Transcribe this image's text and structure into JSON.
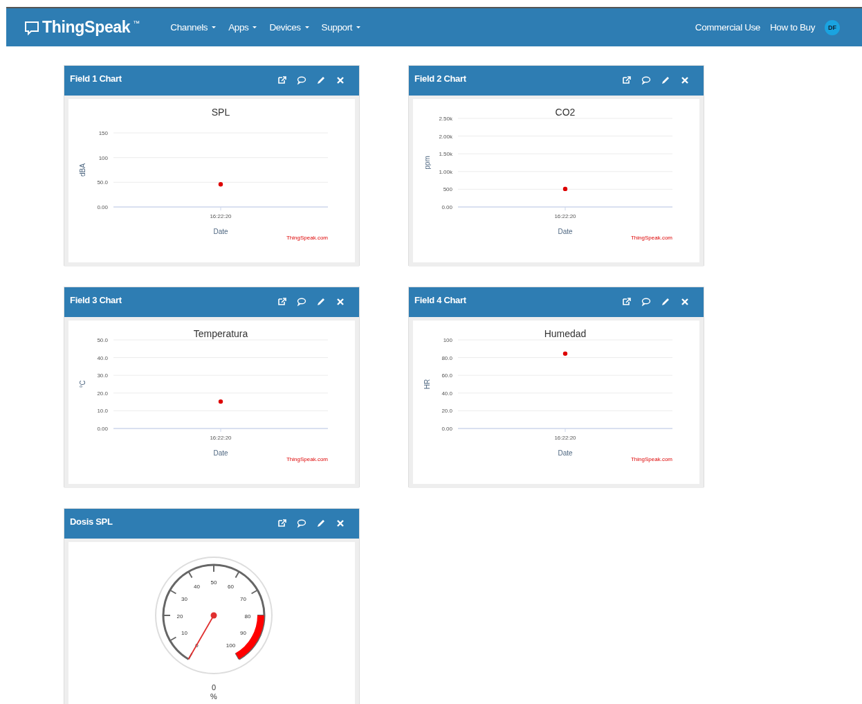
{
  "navbar": {
    "brand": "ThingSpeak",
    "trademark": "™",
    "menus": [
      {
        "label": "Channels"
      },
      {
        "label": "Apps"
      },
      {
        "label": "Devices"
      },
      {
        "label": "Support"
      }
    ],
    "links": [
      "Commercial Use",
      "How to Buy"
    ],
    "avatar": "DF"
  },
  "widgets": [
    {
      "kind": "chart",
      "title": "Field 1 Chart",
      "chart_data": {
        "type": "scatter",
        "title": "SPL",
        "xlabel": "Date",
        "ylabel": "dBA",
        "categories": [
          "16:22:20"
        ],
        "grid": true,
        "series": [
          {
            "color": "#dd0000",
            "values": [
              46
            ]
          }
        ],
        "ylim": [
          0,
          150
        ],
        "yticks": [
          {
            "value": 0,
            "label": "0.00"
          },
          {
            "value": 50,
            "label": "50.0"
          },
          {
            "value": 100,
            "label": "100"
          },
          {
            "value": 150,
            "label": "150"
          }
        ],
        "annotations": [
          "ThingSpeak.com"
        ]
      }
    },
    {
      "kind": "chart",
      "title": "Field 2 Chart",
      "chart_data": {
        "type": "scatter",
        "title": "CO2",
        "xlabel": "Date",
        "ylabel": "ppm",
        "categories": [
          "16:22:20"
        ],
        "grid": true,
        "series": [
          {
            "color": "#dd0000",
            "values": [
              510
            ]
          }
        ],
        "ylim": [
          0,
          2500
        ],
        "yticks": [
          {
            "value": 0,
            "label": "0.00"
          },
          {
            "value": 500,
            "label": "500"
          },
          {
            "value": 1000,
            "label": "1.00k"
          },
          {
            "value": 1500,
            "label": "1.50k"
          },
          {
            "value": 2000,
            "label": "2.00k"
          },
          {
            "value": 2500,
            "label": "2.50k"
          }
        ],
        "annotations": [
          "ThingSpeak.com"
        ]
      }
    },
    {
      "kind": "chart",
      "title": "Field 3 Chart",
      "chart_data": {
        "type": "scatter",
        "title": "Temperatura",
        "xlabel": "Date",
        "ylabel": "°C",
        "categories": [
          "16:22:20"
        ],
        "grid": true,
        "series": [
          {
            "color": "#dd0000",
            "values": [
              15.2
            ]
          }
        ],
        "ylim": [
          0,
          50
        ],
        "yticks": [
          {
            "value": 0,
            "label": "0.00"
          },
          {
            "value": 10,
            "label": "10.0"
          },
          {
            "value": 20,
            "label": "20.0"
          },
          {
            "value": 30,
            "label": "30.0"
          },
          {
            "value": 40,
            "label": "40.0"
          },
          {
            "value": 50,
            "label": "50.0"
          }
        ],
        "annotations": [
          "ThingSpeak.com"
        ]
      }
    },
    {
      "kind": "chart",
      "title": "Field 4 Chart",
      "chart_data": {
        "type": "scatter",
        "title": "Humedad",
        "xlabel": "Date",
        "ylabel": "HR",
        "categories": [
          "16:22:20"
        ],
        "grid": true,
        "series": [
          {
            "color": "#dd0000",
            "values": [
              84.5
            ]
          }
        ],
        "ylim": [
          0,
          100
        ],
        "yticks": [
          {
            "value": 0,
            "label": "0.00"
          },
          {
            "value": 20,
            "label": "20.0"
          },
          {
            "value": 40,
            "label": "40.0"
          },
          {
            "value": 60,
            "label": "60.0"
          },
          {
            "value": 80,
            "label": "80.0"
          },
          {
            "value": 100,
            "label": "100"
          }
        ],
        "annotations": [
          "ThingSpeak.com"
        ]
      }
    },
    {
      "kind": "gauge",
      "title": "Dosis SPL",
      "gauge": {
        "tick_labels": [
          "0",
          "10",
          "20",
          "30",
          "40",
          "50",
          "60",
          "70",
          "80",
          "90",
          "100"
        ],
        "value": "0",
        "unit": "%"
      }
    }
  ]
}
